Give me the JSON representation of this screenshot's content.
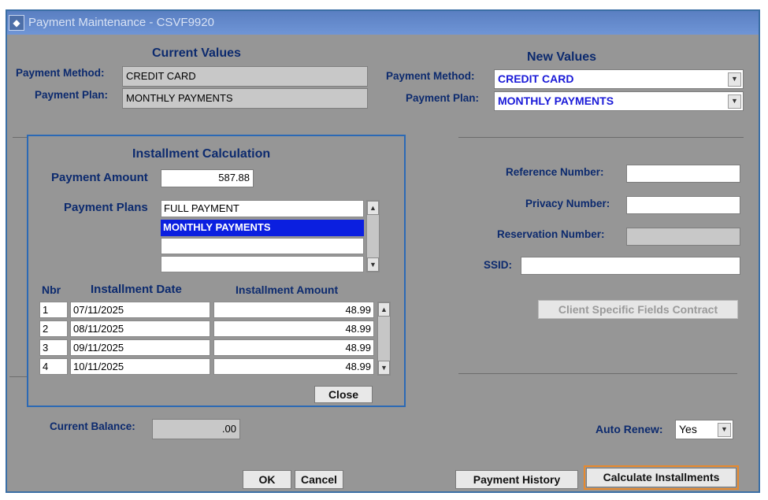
{
  "window": {
    "title": "Payment Maintenance - CSVF9920"
  },
  "current_values": {
    "header": "Current Values",
    "payment_method_label": "Payment Method:",
    "payment_method_value": "CREDIT CARD",
    "payment_plan_label": "Payment Plan:",
    "payment_plan_value": "MONTHLY PAYMENTS"
  },
  "new_values": {
    "header": "New Values",
    "payment_method_label": "Payment Method:",
    "payment_method_value": "CREDIT CARD",
    "payment_plan_label": "Payment Plan:",
    "payment_plan_value": "MONTHLY PAYMENTS"
  },
  "installment_calculation": {
    "header": "Installment Calculation",
    "payment_amount_label": "Payment Amount",
    "payment_amount_value": "587.88",
    "payment_plans_label": "Payment Plans",
    "payment_plans": [
      "FULL PAYMENT",
      "MONTHLY PAYMENTS",
      "",
      ""
    ],
    "selected_plan": "MONTHLY PAYMENTS",
    "columns": {
      "nbr": "Nbr",
      "date": "Installment Date",
      "amount": "Installment Amount"
    },
    "rows": [
      {
        "nbr": "1",
        "date": "07/11/2025",
        "amount": "48.99"
      },
      {
        "nbr": "2",
        "date": "08/11/2025",
        "amount": "48.99"
      },
      {
        "nbr": "3",
        "date": "09/11/2025",
        "amount": "48.99"
      },
      {
        "nbr": "4",
        "date": "10/11/2025",
        "amount": "48.99"
      }
    ],
    "close_label": "Close"
  },
  "right_fields": {
    "reference_number_label": "Reference Number:",
    "reference_number_value": "",
    "privacy_number_label": "Privacy Number:",
    "privacy_number_value": "",
    "reservation_number_label": "Reservation Number:",
    "reservation_number_value": "",
    "ssid_label": "SSID:",
    "ssid_value": "",
    "client_specific_label": "Client Specific Fields Contract"
  },
  "footer": {
    "current_balance_label": "Current Balance:",
    "current_balance_value": ".00",
    "auto_renew_label": "Auto Renew:",
    "auto_renew_value": "Yes",
    "ok_label": "OK",
    "cancel_label": "Cancel",
    "payment_history_label": "Payment History",
    "calculate_installments_label": "Calculate Installments"
  },
  "colors": {
    "window_bg": "#969696",
    "label_text": "#0c2a6e",
    "selection": "#0b1fe0",
    "highlight_border": "#e8892c",
    "panel_border": "#2b69b5"
  }
}
